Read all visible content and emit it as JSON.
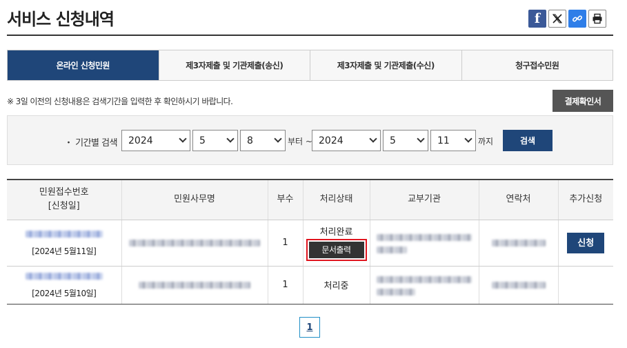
{
  "header": {
    "title": "서비스 신청내역"
  },
  "share": [
    {
      "name": "facebook-icon",
      "glyph": "f"
    },
    {
      "name": "x-icon"
    },
    {
      "name": "link-icon"
    },
    {
      "name": "print-icon"
    }
  ],
  "tabs": [
    {
      "label": "온라인 신청민원",
      "active": true
    },
    {
      "label": "제3자제출 및 기관제출(송신)",
      "active": false
    },
    {
      "label": "제3자제출 및 기관제출(수신)",
      "active": false
    },
    {
      "label": "청구접수민원",
      "active": false
    }
  ],
  "notice": "※ 3일 이전의 신청내용은 검색기간을 입력한 후 확인하시기 바랍니다.",
  "confirm_button": "결제확인서",
  "search": {
    "label": "・ 기간별 검색",
    "from_year": "2024",
    "from_month": "5",
    "from_day": "8",
    "from_suffix": "부터 ~",
    "to_year": "2024",
    "to_month": "5",
    "to_day": "11",
    "to_suffix": "까지",
    "button": "검색"
  },
  "table": {
    "headers": {
      "receipt": "민원접수번호",
      "receipt_sub": "[신청일]",
      "service": "민원사무명",
      "copies": "부수",
      "status": "처리상태",
      "agency": "교부기관",
      "contact": "연락처",
      "extra": "추가신청"
    },
    "rows": [
      {
        "date": "[2024년 5월11일]",
        "copies": "1",
        "status": "처리완료",
        "print_button": "문서출력",
        "apply_button": "신청"
      },
      {
        "date": "[2024년 5월10일]",
        "copies": "1",
        "status": "처리중"
      }
    ]
  },
  "pagination": {
    "current": "1"
  }
}
